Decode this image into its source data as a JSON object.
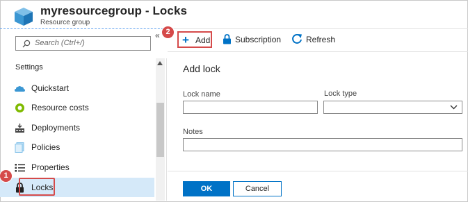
{
  "header": {
    "title": "myresourcegroup - Locks",
    "subtitle": "Resource group",
    "icon": "cube-icon"
  },
  "sidebar": {
    "search_placeholder": "Search (Ctrl+/)",
    "collapse_label": "«",
    "section_heading": "Settings",
    "items": [
      {
        "label": "Quickstart",
        "icon": "cloud-icon"
      },
      {
        "label": "Resource costs",
        "icon": "cost-icon"
      },
      {
        "label": "Deployments",
        "icon": "deployments-icon"
      },
      {
        "label": "Policies",
        "icon": "policies-icon"
      },
      {
        "label": "Properties",
        "icon": "properties-icon"
      },
      {
        "label": "Locks",
        "icon": "lock-icon",
        "selected": true
      }
    ]
  },
  "toolbar": {
    "add_label": "Add",
    "subscription_label": "Subscription",
    "refresh_label": "Refresh"
  },
  "callouts": {
    "step1": "1",
    "step2": "2"
  },
  "add_lock_form": {
    "title": "Add lock",
    "lock_name_label": "Lock name",
    "lock_name_value": "",
    "lock_type_label": "Lock type",
    "lock_type_value": "",
    "notes_label": "Notes",
    "notes_value": "",
    "ok_label": "OK",
    "cancel_label": "Cancel"
  },
  "colors": {
    "accent": "#0072c6",
    "callout": "#d54a4a",
    "selected_bg": "#d5e9f9"
  }
}
